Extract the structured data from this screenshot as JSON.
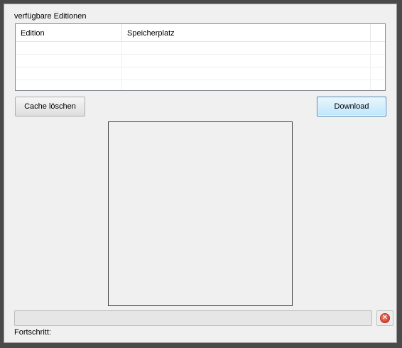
{
  "editions": {
    "title": "verfügbare Editionen",
    "columns": [
      "Edition",
      "Speicherplatz",
      ""
    ],
    "rows": [
      [
        "",
        ""
      ],
      [
        "",
        ""
      ],
      [
        "",
        ""
      ],
      [
        "",
        ""
      ]
    ]
  },
  "buttons": {
    "cache_label": "Cache löschen",
    "download_label": "Download"
  },
  "progress": {
    "label": "Fortschritt:",
    "value": 0
  },
  "icons": {
    "cancel": "cancel-icon",
    "cancel_color": "#d9412e"
  }
}
